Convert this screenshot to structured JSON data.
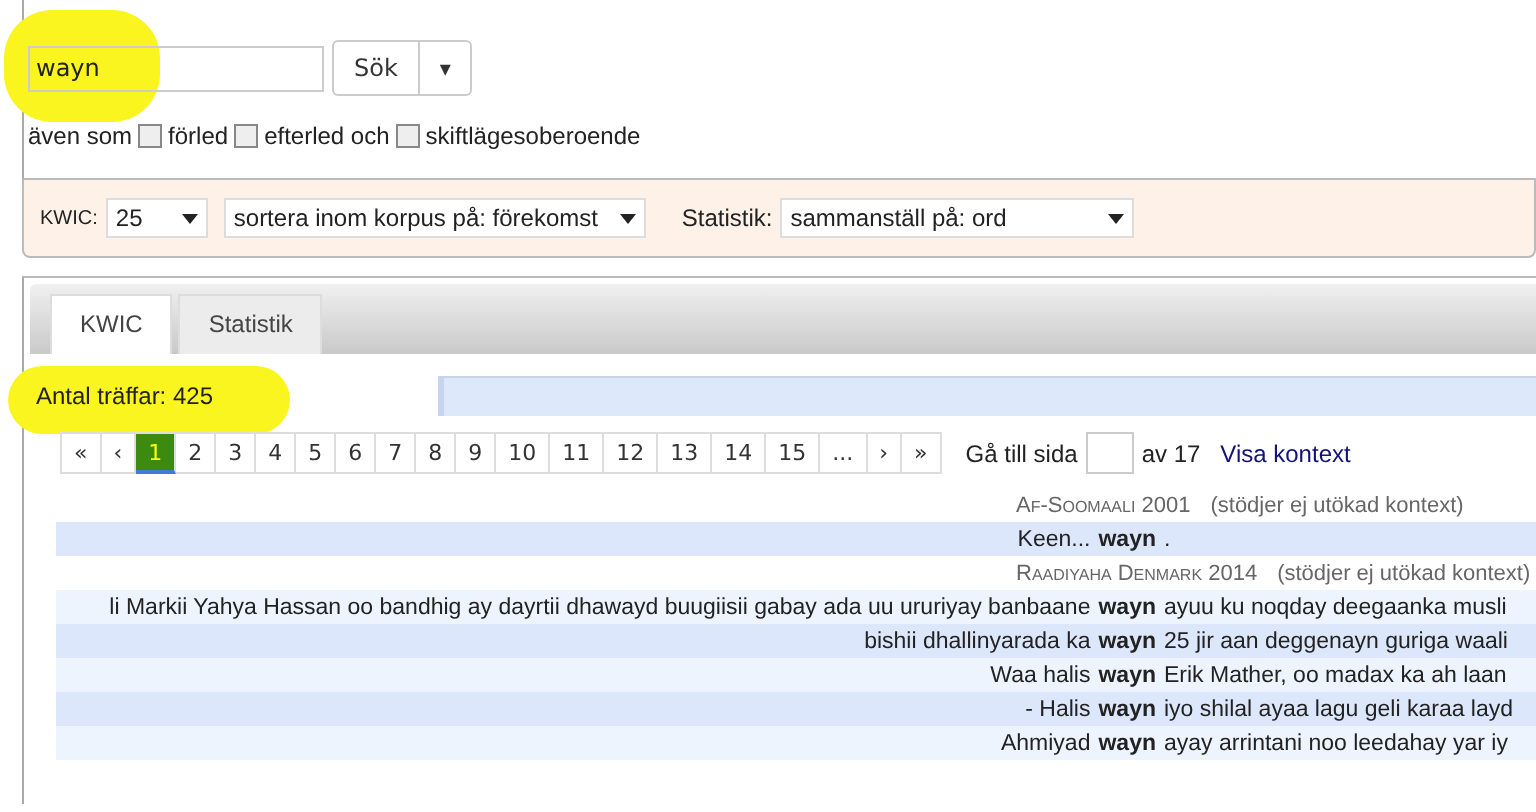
{
  "search": {
    "value": "wayn",
    "button": "Sök",
    "caret": "▾"
  },
  "options": {
    "prefix": "även som",
    "checkboxes": [
      {
        "label": "förled",
        "checked": false
      },
      {
        "label": "efterled och",
        "checked": false
      },
      {
        "label": "skiftlägesoberoende",
        "checked": false
      }
    ]
  },
  "settings": {
    "kwic_label": "KWIC:",
    "kwic_value": "25",
    "sort_value": "sortera inom korpus på: förekomst",
    "stats_label": "Statistik:",
    "stats_value": "sammanställ på: ord"
  },
  "tabs": [
    {
      "label": "KWIC",
      "selected": true
    },
    {
      "label": "Statistik",
      "selected": false
    }
  ],
  "hits": "Antal träffar: 425",
  "pagination": {
    "pages": [
      {
        "label": "«",
        "selected": false
      },
      {
        "label": "‹",
        "selected": false
      },
      {
        "label": "1",
        "selected": true
      },
      {
        "label": "2",
        "selected": false
      },
      {
        "label": "3",
        "selected": false
      },
      {
        "label": "4",
        "selected": false
      },
      {
        "label": "5",
        "selected": false
      },
      {
        "label": "6",
        "selected": false
      },
      {
        "label": "7",
        "selected": false
      },
      {
        "label": "8",
        "selected": false
      },
      {
        "label": "9",
        "selected": false
      },
      {
        "label": "10",
        "selected": false
      },
      {
        "label": "11",
        "selected": false
      },
      {
        "label": "12",
        "selected": false
      },
      {
        "label": "13",
        "selected": false
      },
      {
        "label": "14",
        "selected": false
      },
      {
        "label": "15",
        "selected": false
      },
      {
        "label": "...",
        "selected": false
      },
      {
        "label": "›",
        "selected": false
      },
      {
        "label": "»",
        "selected": false
      }
    ],
    "goto_label": "Gå till sida",
    "total": "av 17",
    "context_link": "Visa kontext"
  },
  "results": [
    {
      "kind": "corpus",
      "name": "Af-Soomaali 2001",
      "note": "(stödjer ej utökad kontext)"
    },
    {
      "kind": "line",
      "left": "Keen...",
      "match": "wayn",
      "right": "."
    },
    {
      "kind": "corpus",
      "name": "Raadiyaha Denmark 2014",
      "note": "(stödjer ej utökad kontext)"
    },
    {
      "kind": "line",
      "left": "li Markii Yahya Hassan oo bandhig ay dayrtii dhawayd buugiisii gabay ada uu ururiyay banbaane",
      "match": "wayn",
      "right": "ayuu ku noqday deegaanka musli"
    },
    {
      "kind": "line",
      "left": "bishii dhallinyarada ka",
      "match": "wayn",
      "right": "25 jir aan deggenayn guriga waali"
    },
    {
      "kind": "line",
      "left": "Waa halis",
      "match": "wayn",
      "right": "Erik Mather, oo madax ka ah laan"
    },
    {
      "kind": "line",
      "left": "- Halis",
      "match": "wayn",
      "right": "iyo shilal ayaa lagu geli karaa layd"
    },
    {
      "kind": "line",
      "left": "Ahmiyad",
      "match": "wayn",
      "right": "ayay arrintani noo leedahay yar iy"
    }
  ]
}
